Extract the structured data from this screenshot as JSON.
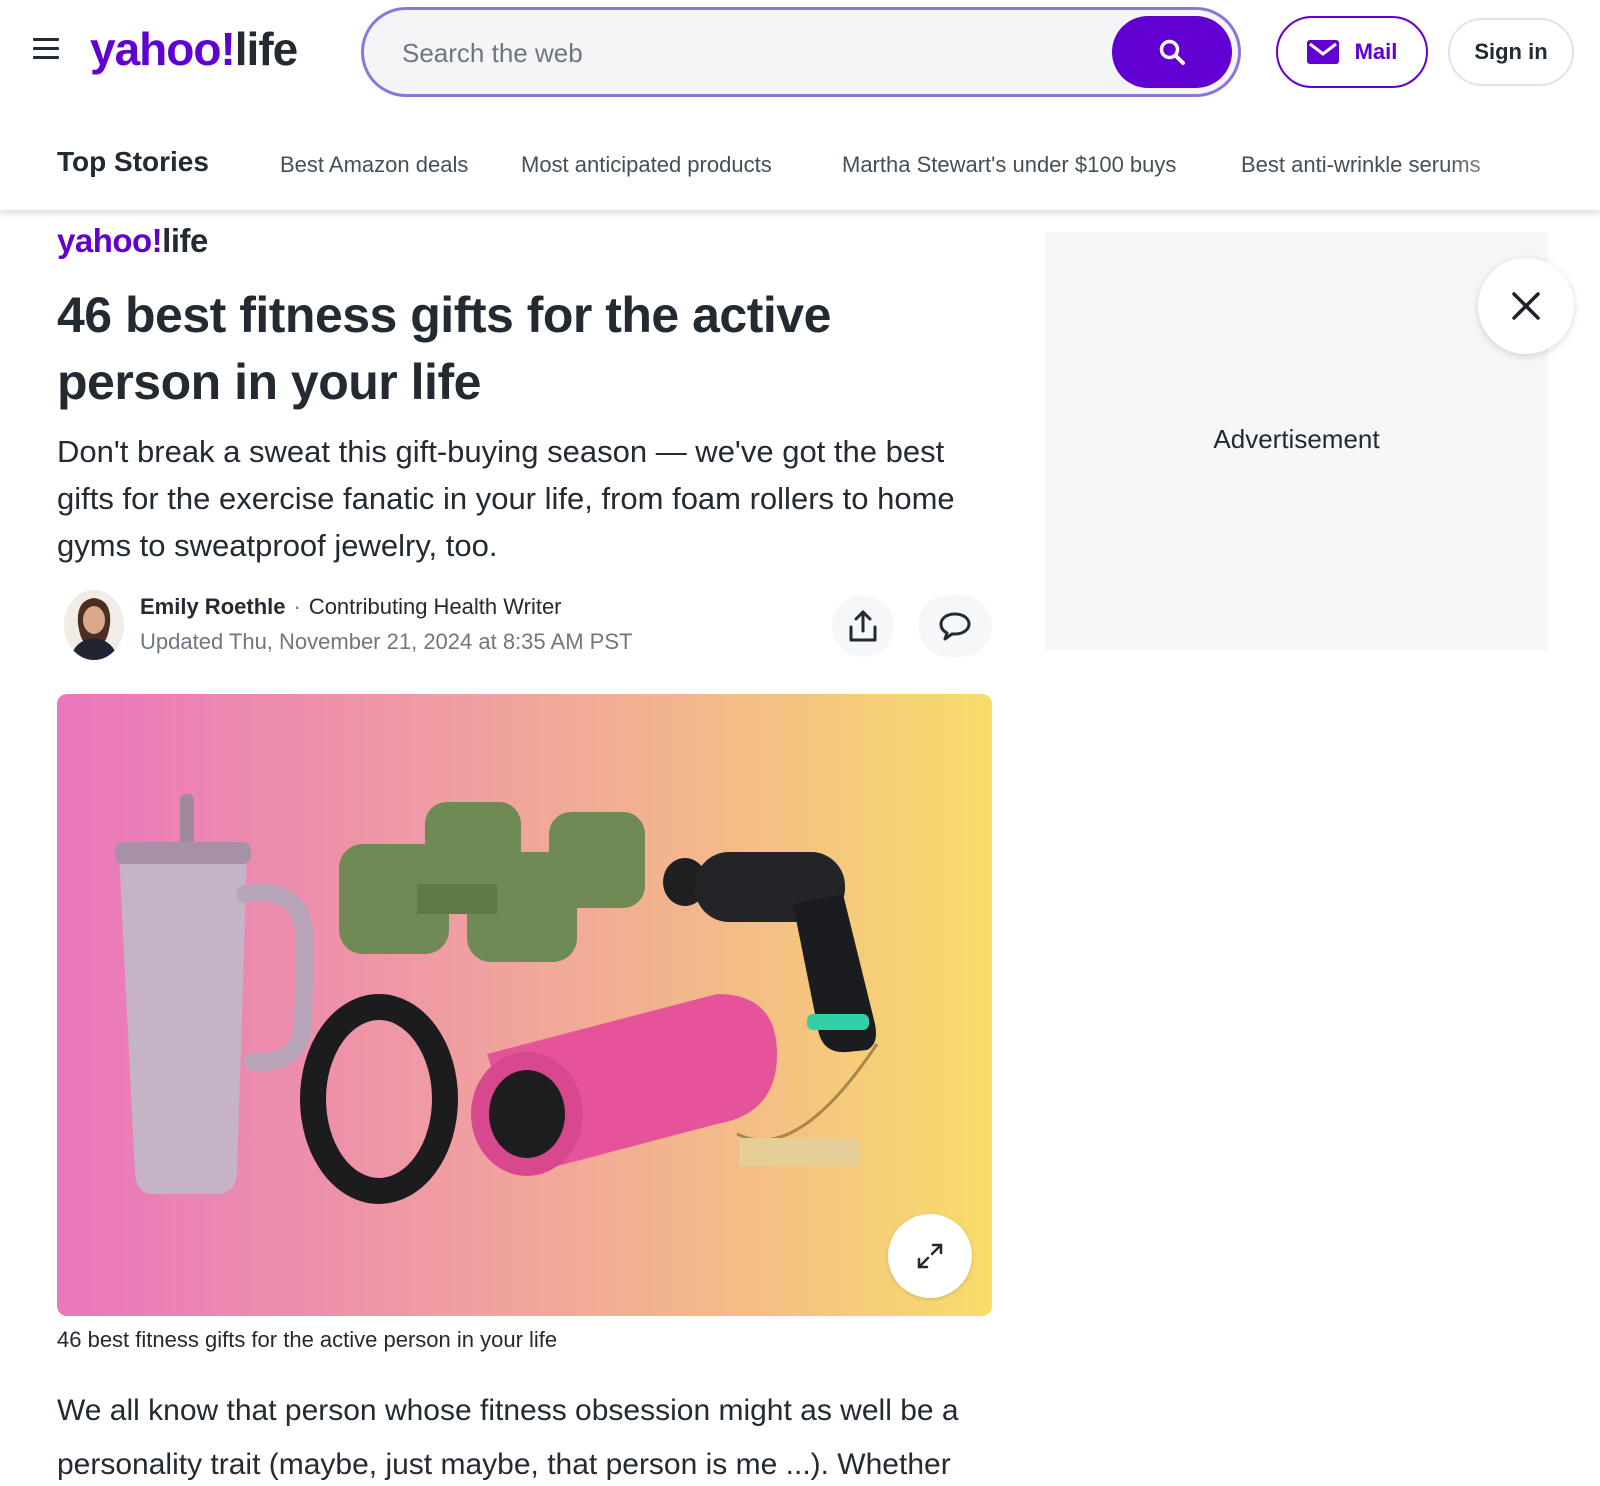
{
  "header": {
    "logo_brand": "yahoo!",
    "logo_section": "life",
    "search_placeholder": "Search the web",
    "mail_label": "Mail",
    "signin_label": "Sign in"
  },
  "nav": {
    "top_label": "Top Stories",
    "links": [
      "Best Amazon deals",
      "Most anticipated products",
      "Martha Stewart's under $100 buys",
      "Best anti-wrinkle serums"
    ]
  },
  "article": {
    "source_brand": "yahoo!",
    "source_section": "life",
    "headline": "46 best fitness gifts for the active person in your life",
    "subhead": "Don't break a sweat this gift-buying season — we've got the best gifts for the exercise fanatic in your life, from foam rollers to home gyms to sweatproof jewelry, too.",
    "author": "Emily Roethle",
    "author_title": "Contributing Health Writer",
    "updated": "Updated Thu, November 21, 2024 at 8:35 AM PST",
    "caption": "46 best fitness gifts for the active person in your life",
    "body": "We all know that person whose fitness obsession might as well be a personality trait (maybe, just maybe, that person is me ...). Whether"
  },
  "ad": {
    "label": "Advertisement"
  },
  "colors": {
    "brand": "#6001d2",
    "text": "#232a31",
    "muted": "#6e7780"
  }
}
